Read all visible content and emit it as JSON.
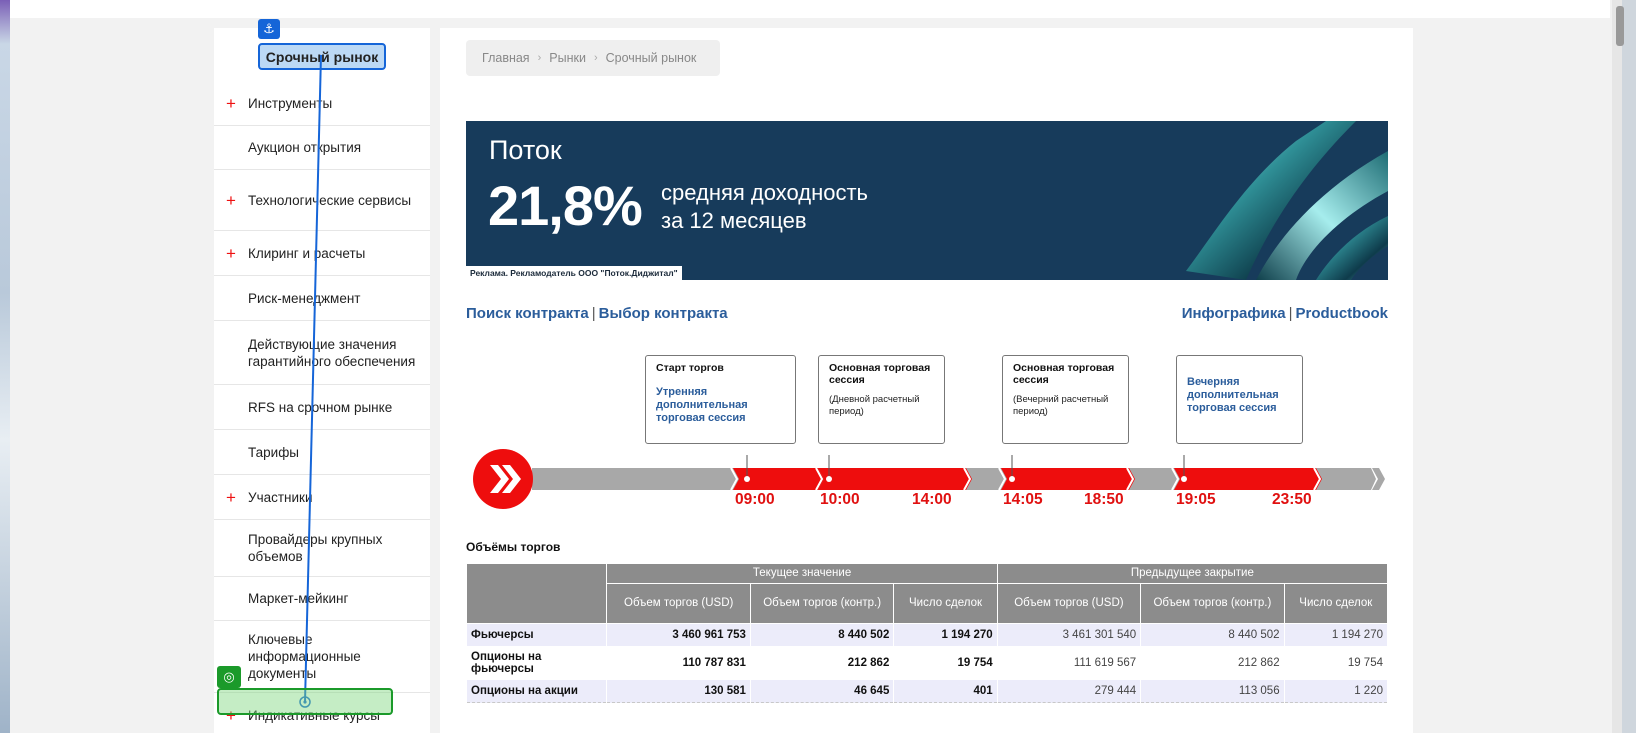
{
  "sidebar": {
    "title": "Срочный рынок",
    "items": [
      {
        "label": "Инструменты",
        "expandable": true
      },
      {
        "label": "Аукцион открытия",
        "expandable": false
      },
      {
        "label": "Технологические сервисы",
        "expandable": true
      },
      {
        "label": "Клиринг и расчеты",
        "expandable": true
      },
      {
        "label": "Риск-менеджмент",
        "expandable": false
      },
      {
        "label": "Действующие значения гарантийного обеспечения",
        "expandable": false
      },
      {
        "label": "RFS на срочном рынке",
        "expandable": false
      },
      {
        "label": "Тарифы",
        "expandable": false
      },
      {
        "label": "Участники",
        "expandable": true
      },
      {
        "label": "Провайдеры крупных объемов",
        "expandable": false
      },
      {
        "label": "Маркет-мейкинг",
        "expandable": false
      },
      {
        "label": "Ключевые информационные документы",
        "expandable": false
      },
      {
        "label": "Индикативные курсы",
        "expandable": true
      }
    ],
    "plus_symbol": "+"
  },
  "breadcrumb": [
    "Главная",
    "Рынки",
    "Срочный рынок"
  ],
  "breadcrumb_separator": "›",
  "banner": {
    "brand": "Поток",
    "rate": "21,8%",
    "line1": "средняя доходность",
    "line2": "за 12 месяцев",
    "disclaimer": "Реклама. Рекламодатель ООО \"Поток.Диджитал\""
  },
  "links": {
    "search": "Поиск контракта",
    "select": "Выбор контракта",
    "infographic": "Инфографика",
    "productbook": "Productbook",
    "separator": "|"
  },
  "timeline": {
    "boxes": [
      {
        "title": "Старт торгов",
        "link": "Утренняя дополнительная торговая сессия",
        "sub": ""
      },
      {
        "title": "Основная торговая сессия",
        "link": "",
        "sub": "(Дневной расчетный период)"
      },
      {
        "title": "Основная торговая сессия",
        "link": "",
        "sub": "(Вечерний расчетный период)"
      },
      {
        "title": "",
        "link": "Вечерняя дополнительная торговая сессия",
        "sub": ""
      }
    ],
    "times": [
      "09:00",
      "10:00",
      "14:00",
      "14:05",
      "18:50",
      "19:05",
      "23:50"
    ],
    "accent_color": "#ee0d0d",
    "gray_color": "#a8a8a8"
  },
  "volumes": {
    "title": "Объёмы торгов",
    "group_current": "Текущее значение",
    "group_previous": "Предыдущее закрытие",
    "columns": [
      "Объем торгов (USD)",
      "Объем торгов (контр.)",
      "Число сделок",
      "Объем торгов (USD)",
      "Объем торгов (контр.)",
      "Число сделок"
    ],
    "rows": [
      {
        "name": "Фьючерсы",
        "values": [
          "3 460 961 753",
          "8 440 502",
          "1 194 270",
          "3 461 301 540",
          "8 440 502",
          "1 194 270"
        ]
      },
      {
        "name": "Опционы на фьючерсы",
        "values": [
          "110 787 831",
          "212 862",
          "19 754",
          "111 619 567",
          "212 862",
          "19 754"
        ]
      },
      {
        "name": "Опционы на акции",
        "values": [
          "130 581",
          "46 645",
          "401",
          "279 444",
          "113 056",
          "1 220"
        ]
      }
    ]
  },
  "overlay": {
    "anchor_icon": "⚓",
    "target_icon": "◎"
  }
}
